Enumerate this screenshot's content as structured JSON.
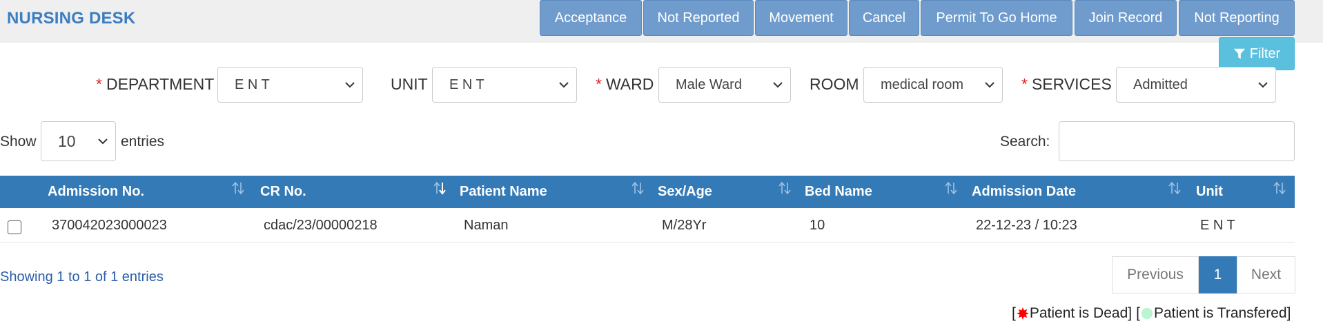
{
  "header": {
    "title": "NURSING DESK",
    "actions": [
      "Acceptance",
      "Not Reported",
      "Movement",
      "Cancel",
      "Permit To Go Home",
      "Join Record",
      "Not Reporting"
    ],
    "filter_label": "Filter"
  },
  "filters": {
    "department": {
      "label": "DEPARTMENT",
      "required_mark": "*",
      "value": "E N T"
    },
    "unit": {
      "label": "UNIT",
      "value": "E N T"
    },
    "ward": {
      "label": "WARD",
      "required_mark": "*",
      "value": "Male Ward"
    },
    "room": {
      "label": "ROOM",
      "value": "medical room"
    },
    "services": {
      "label": "SERVICES",
      "required_mark": "*",
      "value": "Admitted"
    }
  },
  "table_controls": {
    "show_label": "Show",
    "entries_value": "10",
    "entries_label": "entries",
    "search_label": "Search:",
    "search_value": ""
  },
  "table": {
    "columns": [
      "Admission No.",
      "CR No.",
      "Patient Name",
      "Sex/Age",
      "Bed Name",
      "Admission Date",
      "Unit"
    ],
    "rows": [
      {
        "admission_no": "370042023000023",
        "cr_no": "cdac/23/00000218",
        "patient_name": "Naman",
        "sex_age": "M/28Yr",
        "bed_name": "10",
        "admission_date": "22-12-23 / 10:23",
        "unit": "E N T"
      }
    ]
  },
  "footer": {
    "info": "Showing 1 to 1 of 1 entries",
    "pagination": {
      "previous": "Previous",
      "current": "1",
      "next": "Next"
    },
    "legend": {
      "dead": "Patient is Dead",
      "transferred": "Patient is Transfered",
      "open": "[",
      "close": "]"
    }
  },
  "colors": {
    "title": "#3a7dc1",
    "action_button": "#6f9ccc",
    "filter_button": "#5bc0de",
    "table_header": "#337ab7",
    "required_mark": "#e02020",
    "dead_indicator": "#ff0000",
    "transferred_indicator": "#b9f5d0"
  }
}
